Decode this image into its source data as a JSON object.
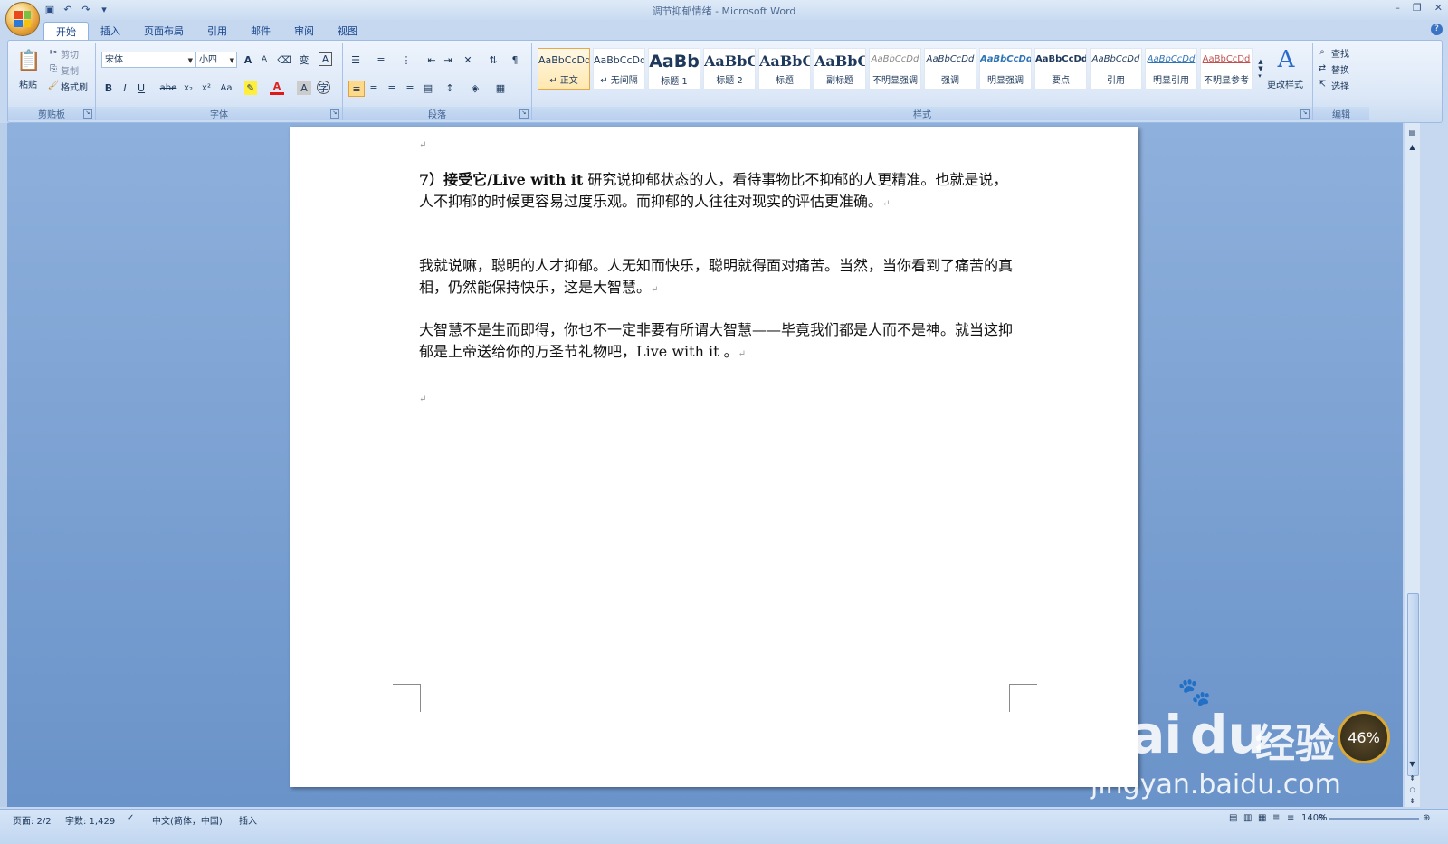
{
  "window": {
    "title": "调节抑郁情绪 - Microsoft Word"
  },
  "tabs": [
    {
      "label": "开始",
      "active": true
    },
    {
      "label": "插入"
    },
    {
      "label": "页面布局"
    },
    {
      "label": "引用"
    },
    {
      "label": "邮件"
    },
    {
      "label": "审阅"
    },
    {
      "label": "视图"
    }
  ],
  "ribbon": {
    "clipboard": {
      "label": "剪贴板",
      "paste": "粘贴",
      "cut": "剪切",
      "copy": "复制",
      "format_painter": "格式刷"
    },
    "font": {
      "label": "字体",
      "font_name": "宋体",
      "font_size": "小四",
      "bold": "B",
      "italic": "I",
      "underline": "U",
      "strike": "abe",
      "subscript": "x₂",
      "superscript": "x²",
      "case": "Aa",
      "color_a": "A",
      "grow": "A",
      "shrink": "A",
      "phonetic": "变",
      "border_char": "A"
    },
    "paragraph": {
      "label": "段落"
    },
    "styles": {
      "label": "样式",
      "items": [
        {
          "preview": "AaBbCcDd",
          "name": "↵ 正文",
          "selected": true
        },
        {
          "preview": "AaBbCcDd",
          "name": "↵ 无间隔"
        },
        {
          "preview": "AaBb",
          "name": "标题 1"
        },
        {
          "preview": "AaBbC",
          "name": "标题 2"
        },
        {
          "preview": "AaBbC",
          "name": "标题"
        },
        {
          "preview": "AaBbC",
          "name": "副标题"
        },
        {
          "preview": "AaBbCcDd",
          "name": "不明显强调"
        },
        {
          "preview": "AaBbCcDd",
          "name": "强调"
        },
        {
          "preview": "AaBbCcDd",
          "name": "明显强调"
        },
        {
          "preview": "AaBbCcDd",
          "name": "要点"
        },
        {
          "preview": "AaBbCcDd",
          "name": "引用"
        },
        {
          "preview": "AaBbCcDd",
          "name": "明显引用"
        },
        {
          "preview": "AaBbCcDd",
          "name": "不明显参考"
        }
      ],
      "change_styles": "更改样式"
    },
    "editing": {
      "label": "编辑",
      "find": "查找",
      "replace": "替换",
      "select": "选择"
    }
  },
  "document": {
    "p1_bold": "7）接受它/Live with it",
    "p1_rest": " 研究说抑郁状态的人，看待事物比不抑郁的人更精准。也就是说，人不抑郁的时候更容易过度乐观。而抑郁的人往往对现实的评估更准确。",
    "p2": "我就说嘛，聪明的人才抑郁。人无知而快乐，聪明就得面对痛苦。当然，当你看到了痛苦的真相，仍然能保持快乐，这是大智慧。",
    "p3": "大智慧不是生而即得，你也不一定非要有所谓大智慧——毕竟我们都是人而不是神。就当这抑郁是上帝送给你的万圣节礼物吧，Live with it 。",
    "para_mark": "↵"
  },
  "status": {
    "page": "页面: 2/2",
    "words": "字数: 1,429",
    "language": "中文(简体，中国)",
    "mode": "插入",
    "zoom": "140%"
  },
  "watermark": {
    "brand": "Bai",
    "du": "du",
    "jy": "经验",
    "url": "jingyan.baidu.com",
    "badge": "46%"
  }
}
